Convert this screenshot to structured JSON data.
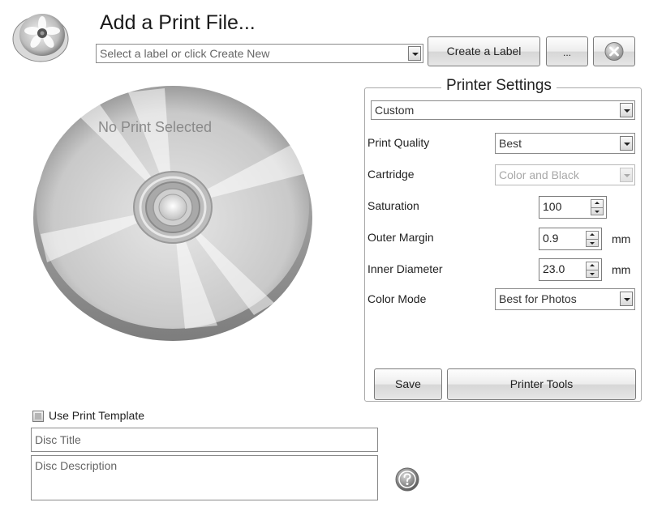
{
  "header": {
    "title": "Add a Print File...",
    "label_combo_placeholder": "Select a label or click Create New",
    "create_label_button": "Create a Label",
    "more_button": "..."
  },
  "preview": {
    "status_text": "No Print Selected"
  },
  "printer_settings": {
    "legend": "Printer Settings",
    "preset": "Custom",
    "print_quality_label": "Print Quality",
    "print_quality_value": "Best",
    "cartridge_label": "Cartridge",
    "cartridge_value": "Color and Black",
    "saturation_label": "Saturation",
    "saturation_value": "100",
    "outer_margin_label": "Outer Margin",
    "outer_margin_value": "0.9",
    "outer_margin_unit": "mm",
    "inner_diameter_label": "Inner Diameter",
    "inner_diameter_value": "23.0",
    "inner_diameter_unit": "mm",
    "color_mode_label": "Color Mode",
    "color_mode_value": "Best for Photos",
    "save_button": "Save",
    "printer_tools_button": "Printer Tools"
  },
  "template": {
    "checkbox_label": "Use Print Template",
    "checked": false,
    "disc_title_placeholder": "Disc Title",
    "disc_description_placeholder": "Disc Description"
  },
  "icons": {
    "app_logo": "disc-with-flower-icon",
    "close": "close-circle-icon",
    "help": "help-circle-icon"
  }
}
